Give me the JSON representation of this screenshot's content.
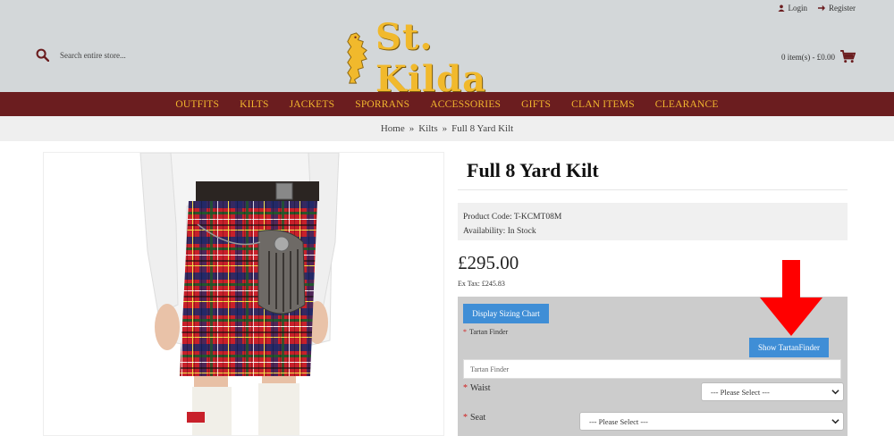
{
  "header": {
    "login_label": "Login",
    "register_label": "Register",
    "search_placeholder": "Search entire store...",
    "logo_text": "St. Kilda",
    "cart_label": "0 item(s) - £0.00"
  },
  "nav": {
    "items": [
      "OUTFITS",
      "KILTS",
      "JACKETS",
      "SPORRANS",
      "ACCESSORIES",
      "GIFTS",
      "CLAN ITEMS",
      "CLEARANCE"
    ]
  },
  "breadcrumb": {
    "items": [
      "Home",
      "Kilts",
      "Full 8 Yard Kilt"
    ],
    "separator": "»"
  },
  "product": {
    "title": "Full 8 Yard Kilt",
    "product_code": "Product Code: T-KCMT08M",
    "availability": "Availability: In Stock",
    "price": "£295.00",
    "ex_tax": "Ex Tax: £245.83"
  },
  "options": {
    "sizing_chart_button": "Display Sizing Chart",
    "tartan_finder_label": "Tartan Finder",
    "tartan_finder_button": "Show TartanFinder",
    "tartan_finder_placeholder": "Tartan Finder",
    "waist_label": "Waist",
    "waist_value": "--- Please Select ---",
    "seat_label": "Seat",
    "seat_value": "--- Please Select ---"
  },
  "colors": {
    "header_bg": "#d3d7d9",
    "nav_bg": "#6b1d1f",
    "nav_text": "#f2b72e",
    "button_blue": "#3f8ed6",
    "arrow_red": "#ff0000",
    "tartan_red": "#c8202a"
  },
  "icons": [
    "user-icon",
    "arrow-right-icon",
    "search-icon",
    "cart-icon",
    "chevron-down-icon",
    "lion-rampant-icon"
  ]
}
